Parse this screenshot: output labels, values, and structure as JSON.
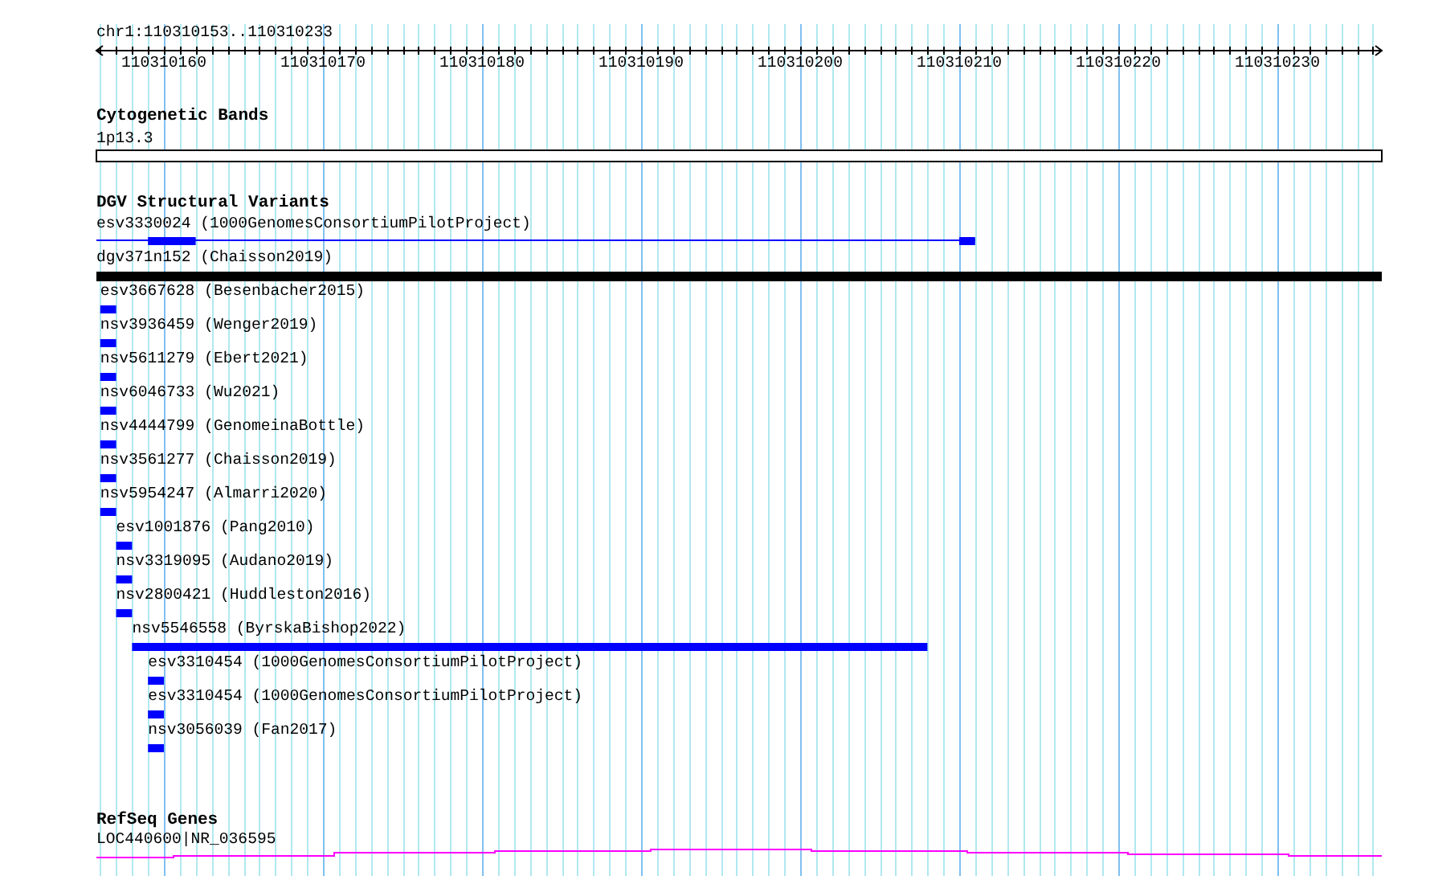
{
  "ruler": {
    "title": "chr1:110310153..110310233",
    "ticks": [
      "110310160",
      "110310170",
      "110310180",
      "110310190",
      "110310200",
      "110310210",
      "110310220",
      "110310230"
    ]
  },
  "cytoband_track": {
    "title": "Cytogenetic Bands",
    "label": "1p13.3"
  },
  "dgv_track": {
    "title": "DGV Structural Variants",
    "features": [
      {
        "label": "esv3330024 (1000GenomesConsortiumPilotProject)",
        "kind": "blocks",
        "color": "#0000ff"
      },
      {
        "label": "dgv371n152 (Chaisson2019)",
        "kind": "bar",
        "color": "#000000"
      },
      {
        "label": "esv3667628 (Besenbacher2015)",
        "kind": "bar",
        "color": "#0000ff"
      },
      {
        "label": "nsv3936459 (Wenger2019)",
        "kind": "bar",
        "color": "#0000ff"
      },
      {
        "label": "nsv5611279 (Ebert2021)",
        "kind": "bar",
        "color": "#0000ff"
      },
      {
        "label": "nsv6046733 (Wu2021)",
        "kind": "bar",
        "color": "#0000ff"
      },
      {
        "label": "nsv4444799 (GenomeinaBottle)",
        "kind": "bar",
        "color": "#0000ff"
      },
      {
        "label": "nsv3561277 (Chaisson2019)",
        "kind": "bar",
        "color": "#0000ff"
      },
      {
        "label": "nsv5954247 (Almarri2020)",
        "kind": "bar",
        "color": "#0000ff"
      },
      {
        "label": "esv1001876 (Pang2010)",
        "kind": "bar",
        "color": "#0000ff"
      },
      {
        "label": "nsv3319095 (Audano2019)",
        "kind": "bar",
        "color": "#0000ff"
      },
      {
        "label": "nsv2800421 (Huddleston2016)",
        "kind": "bar",
        "color": "#0000ff"
      },
      {
        "label": "nsv5546558 (ByrskaBishop2022)",
        "kind": "bar",
        "color": "#0000ff"
      },
      {
        "label": "esv3310454 (1000GenomesConsortiumPilotProject)",
        "kind": "bar",
        "color": "#0000ff"
      },
      {
        "label": "esv3310454 (1000GenomesConsortiumPilotProject)",
        "kind": "bar",
        "color": "#0000ff"
      },
      {
        "label": "nsv3056039 (Fan2017)",
        "kind": "bar",
        "color": "#0000ff"
      }
    ]
  },
  "refseq_track": {
    "title": "RefSeq Genes",
    "label": "LOC440600|NR_036595"
  }
}
